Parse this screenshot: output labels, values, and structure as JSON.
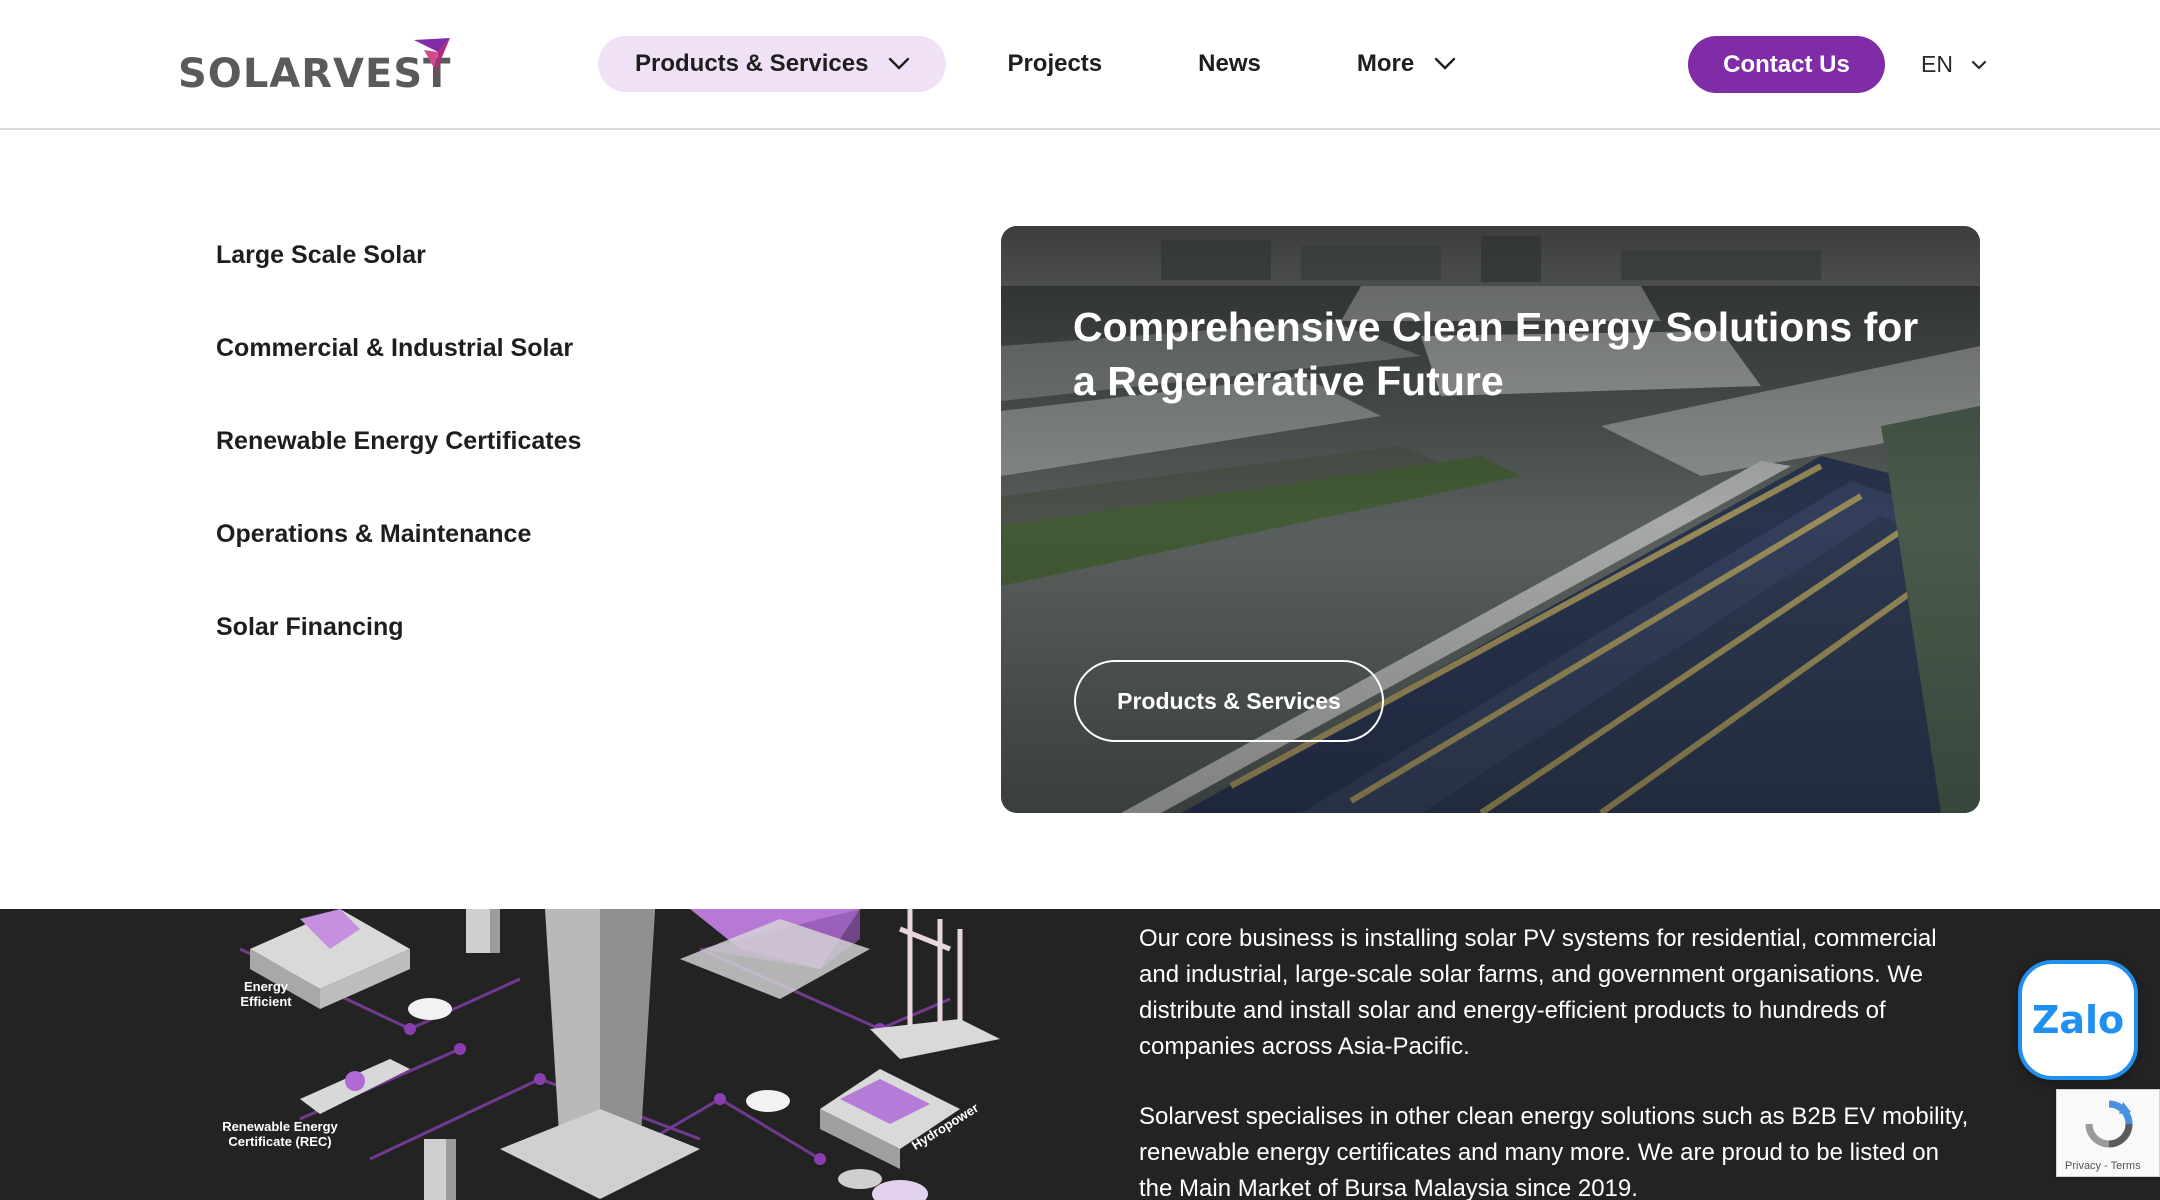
{
  "header": {
    "logo_text": "SOLARVEST",
    "nav": [
      {
        "label": "Products & Services",
        "active": true,
        "has_dropdown": true
      },
      {
        "label": "Projects"
      },
      {
        "label": "News"
      },
      {
        "label": "More",
        "has_dropdown": true
      }
    ],
    "contact_label": "Contact Us",
    "language": "EN"
  },
  "menu": {
    "items": [
      "Large Scale Solar",
      "Commercial & Industrial Solar",
      "Renewable Energy Certificates",
      "Operations & Maintenance",
      "Solar Financing"
    ]
  },
  "promo": {
    "title": "Comprehensive Clean Energy Solutions for a Regenerative Future",
    "button_label": "Products & Services"
  },
  "illustration": {
    "labels": [
      "Energy Efficient",
      "Renewable Energy Certificate (REC)",
      "Hydropower"
    ]
  },
  "about": {
    "paragraphs": [
      "Our core business is installing solar PV systems for residential, commercial and industrial, large-scale solar farms, and government organisations. We distribute and install solar and energy-efficient products to hundreds of companies across Asia-Pacific.",
      "Solarvest specialises in other clean energy solutions such as B2B EV mobility, renewable energy certificates and many more. We are proud to be listed on the Main Market of Bursa Malaysia since 2019."
    ]
  },
  "widgets": {
    "zalo_label": "Zalo",
    "recaptcha_terms": "Privacy - Terms"
  },
  "colors": {
    "brand_purple": "#7f2ca6",
    "nav_active_bg": "#f1e1f6",
    "dark_section": "#232323"
  }
}
